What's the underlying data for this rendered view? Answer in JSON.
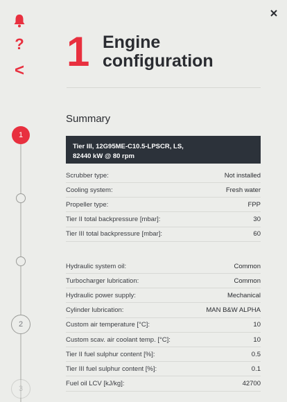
{
  "header": {
    "step_number": "1",
    "title_line1": "Engine",
    "title_line2": "configuration"
  },
  "sidebar": {
    "help_label": "?",
    "back_label": "<"
  },
  "stepper": {
    "steps": [
      {
        "label": "1"
      },
      {
        "label": ""
      },
      {
        "label": ""
      },
      {
        "label": "2"
      },
      {
        "label": "3"
      }
    ]
  },
  "summary": {
    "title": "Summary",
    "banner_line1": "Tier III, 12G95ME-C10.5-LPSCR, LS,",
    "banner_line2": "82440 kW @ 80 rpm",
    "group1": [
      {
        "label": "Scrubber type:",
        "value": "Not installed"
      },
      {
        "label": "Cooling system:",
        "value": "Fresh water"
      },
      {
        "label": "Propeller type:",
        "value": "FPP"
      },
      {
        "label": "Tier II total backpressure [mbar]:",
        "value": "30"
      },
      {
        "label": "Tier III total backpressure [mbar]:",
        "value": "60"
      }
    ],
    "group2": [
      {
        "label": "Hydraulic system oil:",
        "value": "Common"
      },
      {
        "label": "Turbocharger lubrication:",
        "value": "Common"
      },
      {
        "label": "Hydraulic power supply:",
        "value": "Mechanical"
      },
      {
        "label": "Cylinder lubrication:",
        "value": "MAN B&W ALPHA"
      },
      {
        "label": "Custom air temperature [°C]:",
        "value": "10"
      },
      {
        "label": "Custom scav. air coolant temp. [°C]:",
        "value": "10"
      },
      {
        "label": "Tier II fuel sulphur content [%]:",
        "value": "0.5"
      },
      {
        "label": "Tier III fuel sulphur content [%]:",
        "value": "0.1"
      },
      {
        "label": "Fuel oil LCV [kJ/kg]:",
        "value": "42700"
      }
    ]
  },
  "colors": {
    "accent": "#e8303f",
    "banner": "#2c323a",
    "background": "#ecedea"
  }
}
